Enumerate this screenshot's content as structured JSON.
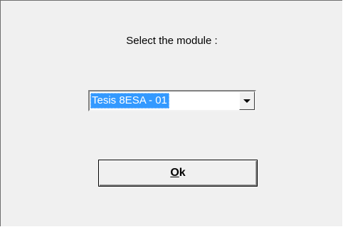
{
  "dialog": {
    "prompt": "Select the module :",
    "module_select": {
      "selected_value": "Tesis 8ESA - 01"
    },
    "ok_button": {
      "mnemonic": "O",
      "rest": "k"
    }
  },
  "colors": {
    "dialog_background": "#f0f0f0",
    "selection_highlight": "#3399ff"
  },
  "icons": {
    "dropdown": "chevron-down-icon"
  }
}
